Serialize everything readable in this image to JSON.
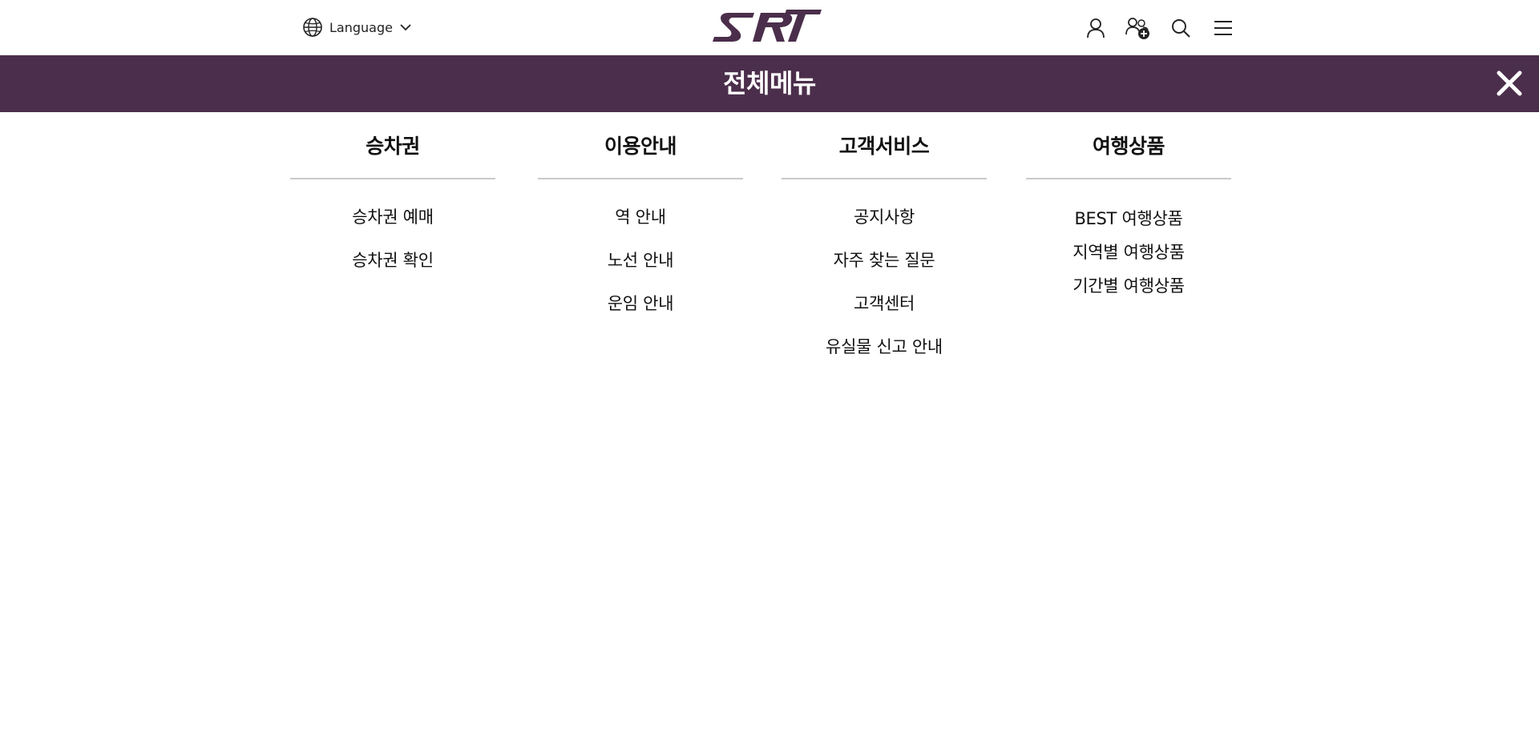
{
  "header": {
    "language_label": "Language",
    "logo_text": "SRT",
    "icons": [
      "globe-icon",
      "chevron-down-icon",
      "user-icon",
      "user-add-icon",
      "search-icon",
      "hamburger-menu-icon",
      "close-icon"
    ]
  },
  "menu_bar": {
    "title": "전체메뉴",
    "background_color": "#4b2e4b"
  },
  "columns": [
    {
      "title": "승차권",
      "items": [
        "승차권 예매",
        "승차권 확인"
      ]
    },
    {
      "title": "이용안내",
      "items": [
        "역 안내",
        "노선 안내",
        "운임 안내"
      ]
    },
    {
      "title": "고객서비스",
      "items": [
        "공지사항",
        "자주 찾는 질문",
        "고객센터",
        "유실물 신고 안내"
      ]
    },
    {
      "title": "여행상품",
      "items": [
        "BEST 여행상품",
        "지역별 여행상품",
        "기간별 여행상품"
      ]
    }
  ]
}
